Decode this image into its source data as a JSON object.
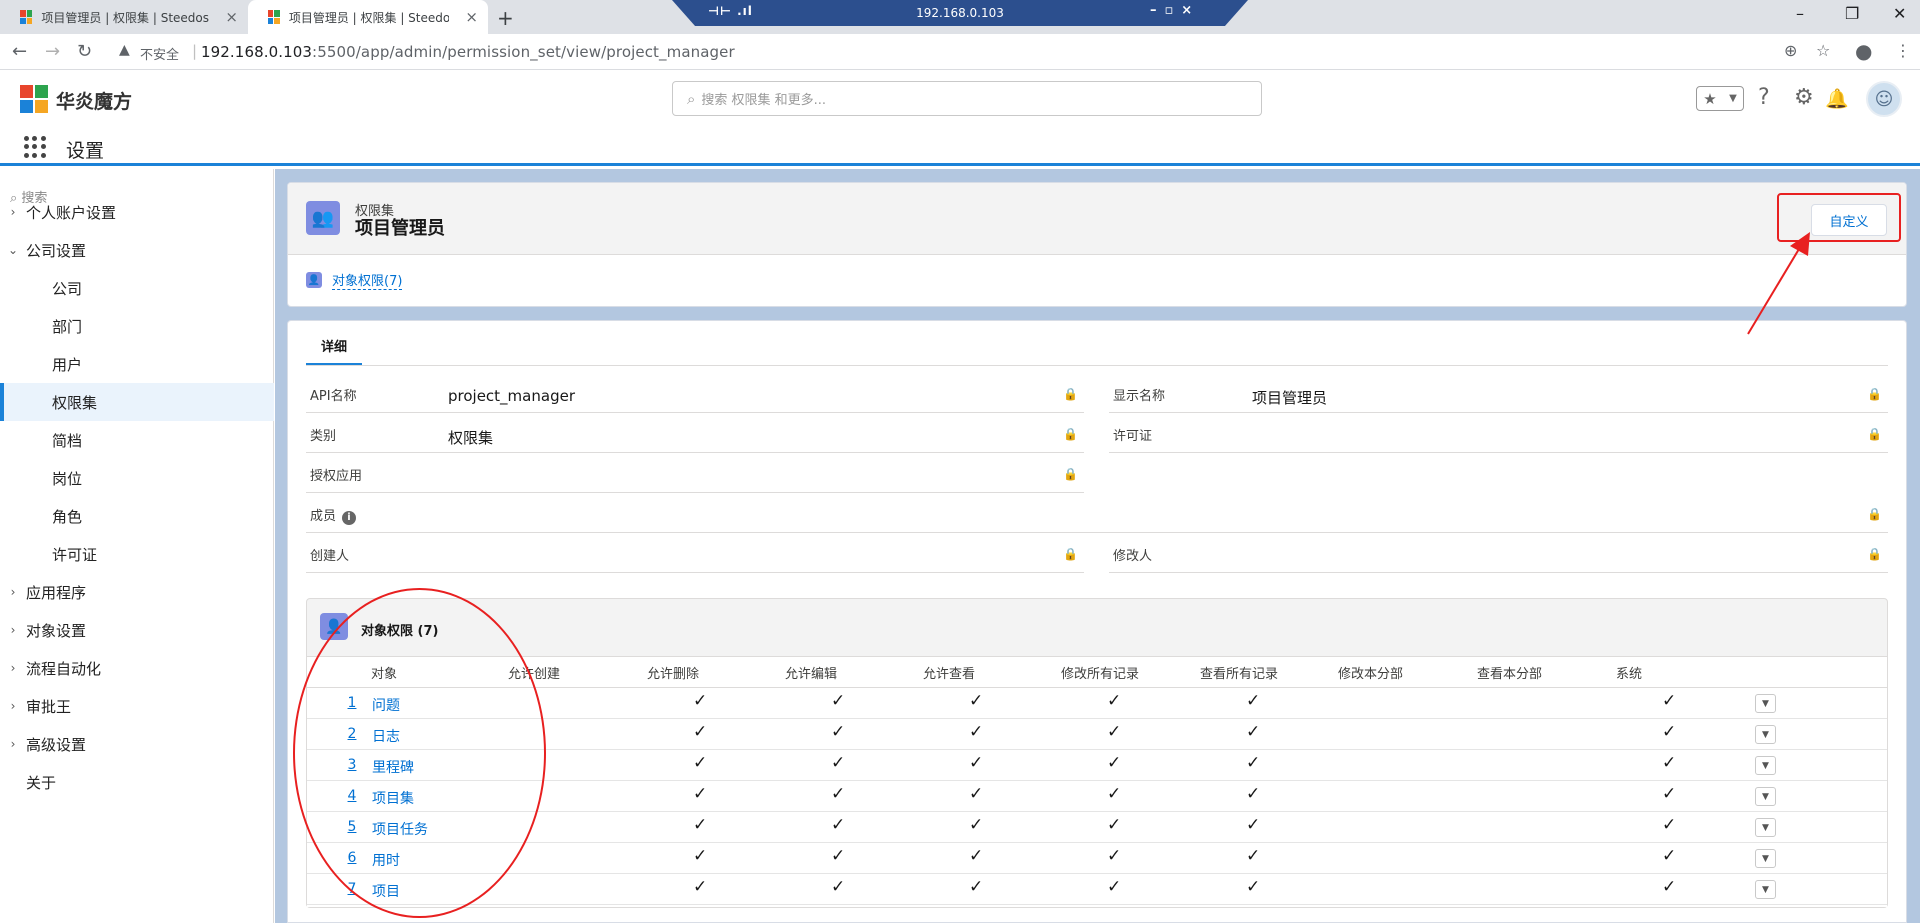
{
  "browser": {
    "tabs": [
      {
        "title": "项目管理员 | 权限集 | Steedos",
        "active": false
      },
      {
        "title": "项目管理员 | 权限集 | Steedos",
        "active": true
      }
    ],
    "new_tab_symbol": "+",
    "close_symbol": "×",
    "remote_host": "192.168.0.103",
    "insecure_label": "不安全",
    "url_host": "192.168.0.103",
    "url_path": ":5500/app/admin/permission_set/view/project_manager"
  },
  "header": {
    "brand": "华炎魔方",
    "search_placeholder": "搜索 权限集 和更多...",
    "app_name": "设置",
    "brand_colors": [
      "#e8452c",
      "#2da44e",
      "#1b82d8",
      "#f5a623"
    ]
  },
  "sidebar": {
    "search_placeholder": "搜索",
    "items": [
      {
        "label": "个人账户设置",
        "type": "group",
        "expanded": false
      },
      {
        "label": "公司设置",
        "type": "group",
        "expanded": true
      },
      {
        "label": "公司",
        "type": "sub"
      },
      {
        "label": "部门",
        "type": "sub"
      },
      {
        "label": "用户",
        "type": "sub"
      },
      {
        "label": "权限集",
        "type": "sub",
        "active": true
      },
      {
        "label": "简档",
        "type": "sub"
      },
      {
        "label": "岗位",
        "type": "sub"
      },
      {
        "label": "角色",
        "type": "sub"
      },
      {
        "label": "许可证",
        "type": "sub"
      },
      {
        "label": "应用程序",
        "type": "group",
        "expanded": false
      },
      {
        "label": "对象设置",
        "type": "group",
        "expanded": false
      },
      {
        "label": "流程自动化",
        "type": "group",
        "expanded": false
      },
      {
        "label": "审批王",
        "type": "group",
        "expanded": false
      },
      {
        "label": "高级设置",
        "type": "group",
        "expanded": false
      },
      {
        "label": "关于",
        "type": "leaf"
      }
    ]
  },
  "record": {
    "object_type": "权限集",
    "name": "项目管理员",
    "customize_label": "自定义",
    "related_link": "对象权限(7)"
  },
  "detail": {
    "tab": "详细",
    "fields": {
      "api_name": {
        "label": "API名称",
        "value": "project_manager"
      },
      "display_name": {
        "label": "显示名称",
        "value": "项目管理员"
      },
      "type": {
        "label": "类别",
        "value": "权限集"
      },
      "license": {
        "label": "许可证",
        "value": ""
      },
      "assigned_apps": {
        "label": "授权应用",
        "value": ""
      },
      "members": {
        "label": "成员",
        "value": ""
      },
      "created_by": {
        "label": "创建人",
        "value": ""
      },
      "modified_by": {
        "label": "修改人",
        "value": ""
      }
    }
  },
  "object_permissions": {
    "title": "对象权限 (7)",
    "columns": [
      "对象",
      "允许创建",
      "允许删除",
      "允许编辑",
      "允许查看",
      "修改所有记录",
      "查看所有记录",
      "修改本分部",
      "查看本分部",
      "系统"
    ],
    "rows": [
      {
        "num": "1",
        "object": "问题",
        "perms": [
          false,
          true,
          true,
          true,
          true,
          true,
          false,
          false,
          true
        ]
      },
      {
        "num": "2",
        "object": "日志",
        "perms": [
          false,
          true,
          true,
          true,
          true,
          true,
          false,
          false,
          true
        ]
      },
      {
        "num": "3",
        "object": "里程碑",
        "perms": [
          false,
          true,
          true,
          true,
          true,
          true,
          false,
          false,
          true
        ]
      },
      {
        "num": "4",
        "object": "项目集",
        "perms": [
          false,
          true,
          true,
          true,
          true,
          true,
          false,
          false,
          true
        ]
      },
      {
        "num": "5",
        "object": "项目任务",
        "perms": [
          false,
          true,
          true,
          true,
          true,
          true,
          false,
          false,
          true
        ]
      },
      {
        "num": "6",
        "object": "用时",
        "perms": [
          false,
          true,
          true,
          true,
          true,
          true,
          false,
          false,
          true
        ]
      },
      {
        "num": "7",
        "object": "项目",
        "perms": [
          false,
          true,
          true,
          true,
          true,
          true,
          false,
          false,
          true
        ]
      }
    ],
    "check_symbol": "✓"
  },
  "colors": {
    "accent": "#1b82d8",
    "link": "#0070d2",
    "icon_purple": "#7f8de1",
    "annotation_red": "#e82020",
    "main_bg": "#b3c7e0"
  }
}
